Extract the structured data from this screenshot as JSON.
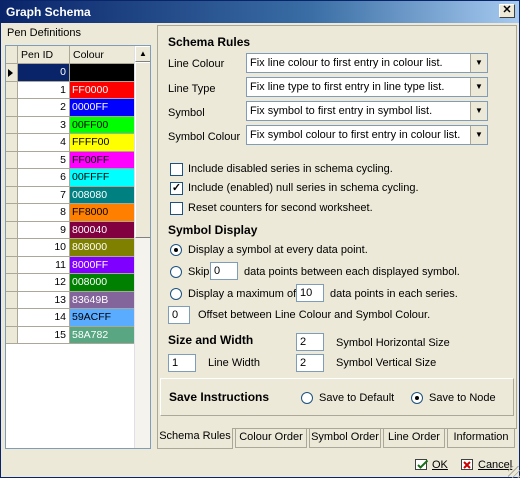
{
  "window": {
    "title": "Graph Schema",
    "close_label": "✕"
  },
  "pen_definitions": {
    "title": "Pen Definitions",
    "headers": {
      "id": "Pen ID",
      "colour": "Colour"
    },
    "rows": [
      {
        "id": "0",
        "colour": "",
        "hex": "#000000"
      },
      {
        "id": "1",
        "colour": "FF0000",
        "hex": "#FF0000"
      },
      {
        "id": "2",
        "colour": "0000FF",
        "hex": "#0000FF"
      },
      {
        "id": "3",
        "colour": "00FF00",
        "hex": "#00FF00"
      },
      {
        "id": "4",
        "colour": "FFFF00",
        "hex": "#FFFF00"
      },
      {
        "id": "5",
        "colour": "FF00FF",
        "hex": "#FF00FF"
      },
      {
        "id": "6",
        "colour": "00FFFF",
        "hex": "#00FFFF"
      },
      {
        "id": "7",
        "colour": "008080",
        "hex": "#008080"
      },
      {
        "id": "8",
        "colour": "FF8000",
        "hex": "#FF8000"
      },
      {
        "id": "9",
        "colour": "800040",
        "hex": "#800040"
      },
      {
        "id": "10",
        "colour": "808000",
        "hex": "#808000"
      },
      {
        "id": "11",
        "colour": "8000FF",
        "hex": "#8000FF"
      },
      {
        "id": "12",
        "colour": "008000",
        "hex": "#008000"
      },
      {
        "id": "13",
        "colour": "83649B",
        "hex": "#83649B"
      },
      {
        "id": "14",
        "colour": "59ACFF",
        "hex": "#59ACFF"
      },
      {
        "id": "15",
        "colour": "58A782",
        "hex": "#58A782"
      }
    ]
  },
  "schema_rules": {
    "title": "Schema Rules",
    "line_colour": {
      "label": "Line Colour",
      "value": "Fix line colour to first entry in colour list."
    },
    "line_type": {
      "label": "Line Type",
      "value": "Fix line type to first entry in line type list."
    },
    "symbol": {
      "label": "Symbol",
      "value": "Fix symbol to first entry in symbol list."
    },
    "symbol_colour": {
      "label": "Symbol Colour",
      "value": "Fix symbol colour to first entry in colour list."
    },
    "cb_disabled": {
      "label": "Include disabled series in schema cycling.",
      "checked": false,
      "mark": ""
    },
    "cb_null": {
      "label": "Include (enabled) null series in schema cycling.",
      "checked": true,
      "mark": "✓"
    },
    "cb_reset": {
      "label": "Reset counters for second worksheet.",
      "checked": false,
      "mark": ""
    }
  },
  "symbol_display": {
    "title": "Symbol Display",
    "opt_every": "Display a symbol at every data point.",
    "opt_skip": "Skip",
    "skip_value": "0",
    "skip_suffix": "data points between each displayed symbol.",
    "opt_max": "Display a maximum of",
    "max_value": "10",
    "max_suffix": "data points in each series.",
    "offset_value": "0",
    "offset_label": "Offset between Line Colour and Symbol Colour."
  },
  "size_width": {
    "title": "Size and Width",
    "line_width_value": "1",
    "line_width_label": "Line Width",
    "sym_h_value": "2",
    "sym_h_label": "Symbol Horizontal Size",
    "sym_v_value": "2",
    "sym_v_label": "Symbol Vertical Size"
  },
  "save_instructions": {
    "title": "Save Instructions",
    "opt_default": "Save to Default",
    "opt_node": "Save to Node"
  },
  "tabs": [
    "Schema Rules",
    "Colour Order",
    "Symbol Order",
    "Line Order",
    "Information"
  ],
  "footer": {
    "ok": "OK",
    "cancel": "Cancel"
  }
}
